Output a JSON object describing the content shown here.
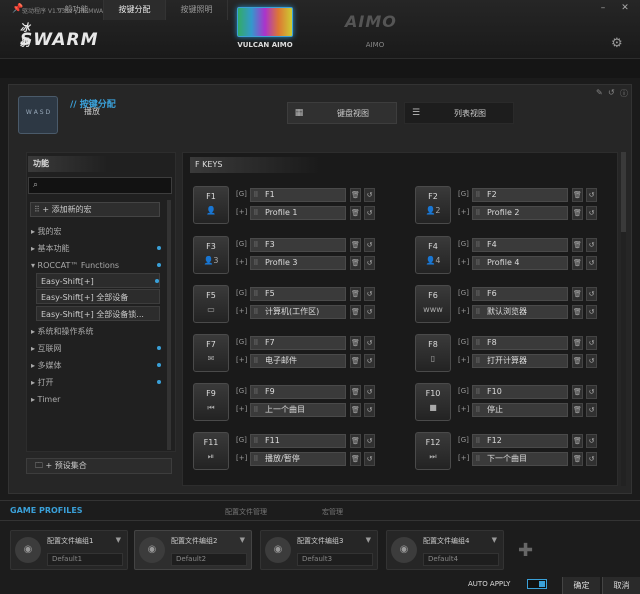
{
  "app": {
    "version": "驱动程序 V1.9357 | FIRMWARE 1.33",
    "logo_cn": "冰豹",
    "logo": "SWARM",
    "device_name": "VULCAN AIMO",
    "aimo_logo": "AIMO",
    "aimo_label": "AIMO",
    "win_minimize": "–",
    "win_close": "✕"
  },
  "tabs": [
    {
      "label": "一般功能"
    },
    {
      "label": "按键分配"
    },
    {
      "label": "按键照明"
    }
  ],
  "profile": {
    "title": "// 按键分配",
    "subtitle": "播放",
    "key_labels": "W A S D"
  },
  "view_buttons": {
    "keyboard": "键盘视图",
    "list": "列表视图"
  },
  "left_panel": {
    "header": "功能",
    "search_value": "",
    "add_macro": "+ 添加新的宏",
    "items": [
      {
        "label": "▸ 我的宏",
        "dot": false
      },
      {
        "label": "▸ 基本功能",
        "dot": true
      },
      {
        "label": "▾ ROCCAT™ Functions",
        "dot": true
      },
      {
        "label": "Easy-Shift[+]",
        "dot": true
      },
      {
        "label": "Easy-Shift[+] 全部设备",
        "dot": false
      },
      {
        "label": "Easy-Shift[+] 全部设备锁...",
        "dot": false
      },
      {
        "label": "▸ 系统和操作系统",
        "dot": false
      },
      {
        "label": "▸ 互联网",
        "dot": true
      },
      {
        "label": "▸ 多媒体",
        "dot": true
      },
      {
        "label": "▸ 打开",
        "dot": true
      },
      {
        "label": "▸ Timer",
        "dot": false
      }
    ],
    "preset": "+ 预设集合"
  },
  "keys_section": "F KEYS",
  "keys": [
    {
      "key": "F1",
      "icon": "👤",
      "g": "F1",
      "p": "Profile 1"
    },
    {
      "key": "F2",
      "icon": "👤2",
      "g": "F2",
      "p": "Profile 2"
    },
    {
      "key": "F3",
      "icon": "👤3",
      "g": "F3",
      "p": "Profile 3"
    },
    {
      "key": "F4",
      "icon": "👤4",
      "g": "F4",
      "p": "Profile 4"
    },
    {
      "key": "F5",
      "icon": "▭",
      "g": "F5",
      "p": "计算机(工作区)"
    },
    {
      "key": "F6",
      "icon": "www",
      "g": "F6",
      "p": "默认浏览器"
    },
    {
      "key": "F7",
      "icon": "✉",
      "g": "F7",
      "p": "电子邮件"
    },
    {
      "key": "F8",
      "icon": "▯",
      "g": "F8",
      "p": "打开计算器"
    },
    {
      "key": "F9",
      "icon": "⏮",
      "g": "F9",
      "p": "上一个曲目"
    },
    {
      "key": "F10",
      "icon": "■",
      "g": "F10",
      "p": "停止"
    },
    {
      "key": "F11",
      "icon": "⏯",
      "g": "F11",
      "p": "播放/暂停"
    },
    {
      "key": "F12",
      "icon": "⏭",
      "g": "F12",
      "p": "下一个曲目"
    }
  ],
  "tag_g": "[G]",
  "tag_p": "[+]",
  "footer": {
    "title": "GAME PROFILES",
    "tab1": "配置文件管理",
    "tab2": "宏管理",
    "slots": [
      {
        "name": "配置文件编组1",
        "default": "Default1"
      },
      {
        "name": "配置文件编组2",
        "default": "Default2"
      },
      {
        "name": "配置文件编组3",
        "default": "Default3"
      },
      {
        "name": "配置文件编组4",
        "default": "Default4"
      }
    ],
    "auto_apply": "AUTO APPLY",
    "ok": "确定",
    "cancel": "取消"
  },
  "colors": {
    "accent": "#3aa0d8"
  }
}
